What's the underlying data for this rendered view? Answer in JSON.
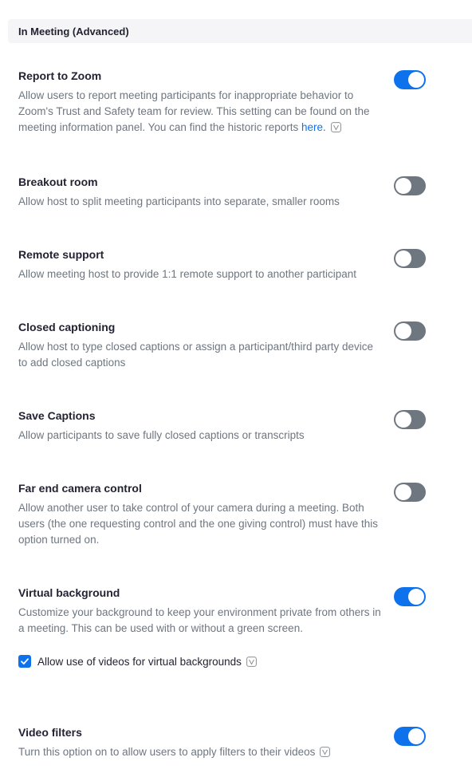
{
  "section": {
    "title": "In Meeting (Advanced)"
  },
  "settings": {
    "report_to_zoom": {
      "title": "Report to Zoom",
      "description": "Allow users to report meeting participants for inappropriate behavior to Zoom's Trust and Safety team for review. This setting can be found on the meeting information panel. You can find the historic reports ",
      "link_text": "here.",
      "enabled": true
    },
    "breakout_room": {
      "title": "Breakout room",
      "description": "Allow host to split meeting participants into separate, smaller rooms",
      "enabled": false
    },
    "remote_support": {
      "title": "Remote support",
      "description": "Allow meeting host to provide 1:1 remote support to another participant",
      "enabled": false
    },
    "closed_captioning": {
      "title": "Closed captioning",
      "description": "Allow host to type closed captions or assign a participant/third party device to add closed captions",
      "enabled": false
    },
    "save_captions": {
      "title": "Save Captions",
      "description": "Allow participants to save fully closed captions or transcripts",
      "enabled": false
    },
    "far_end_camera_control": {
      "title": "Far end camera control",
      "description": "Allow another user to take control of your camera during a meeting. Both users (the one requesting control and the one giving control) must have this option turned on.",
      "enabled": false
    },
    "virtual_background": {
      "title": "Virtual background",
      "description": "Customize your background to keep your environment private from others in a meeting. This can be used with or without a green screen.",
      "enabled": true,
      "option_label": "Allow use of videos for virtual backgrounds",
      "option_checked": true
    },
    "video_filters": {
      "title": "Video filters",
      "description": "Turn this option on to allow users to apply filters to their videos",
      "enabled": true
    }
  },
  "colors": {
    "accent": "#0e72ed",
    "toggle_off": "#6e7680",
    "text_primary": "#232333",
    "text_secondary": "#6e7680",
    "header_bg": "#f5f5f7"
  },
  "icons": {
    "info": "info-icon",
    "check": "checkmark-icon"
  }
}
